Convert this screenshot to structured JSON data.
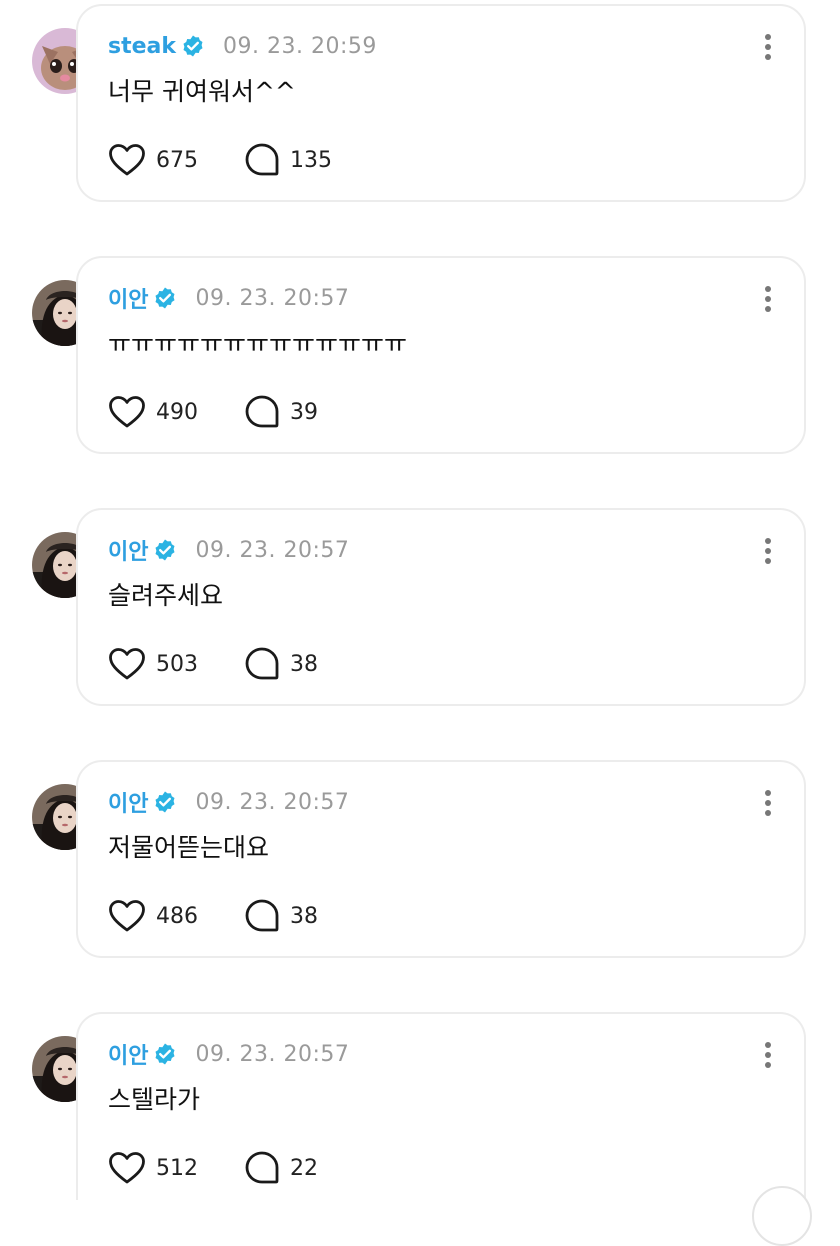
{
  "colors": {
    "name": "#2e9fe0",
    "verified_badge": "#2bb3e3",
    "timestamp": "#9a9a9a",
    "card_border": "#ececec"
  },
  "icons": {
    "verified": "verified-badge-icon",
    "like": "heart-outline-icon",
    "comment": "speech-bubble-icon",
    "more": "more-vertical-icon"
  },
  "posts": [
    {
      "author": "steak",
      "time": "09. 23. 20:59",
      "text": "너무 귀여워서^^",
      "likes": "675",
      "comments": "135"
    },
    {
      "author": "이안",
      "time": "09. 23. 20:57",
      "text": "ㅠㅠㅠㅠㅠㅠㅠㅠㅠㅠㅠㅠㅠ",
      "likes": "490",
      "comments": "39"
    },
    {
      "author": "이안",
      "time": "09. 23. 20:57",
      "text": "슬려주세요",
      "likes": "503",
      "comments": "38"
    },
    {
      "author": "이안",
      "time": "09. 23. 20:57",
      "text": "저물어뜯는대요",
      "likes": "486",
      "comments": "38"
    },
    {
      "author": "이안",
      "time": "09. 23. 20:57",
      "text": "스텔라가",
      "likes": "512",
      "comments": "22"
    }
  ]
}
